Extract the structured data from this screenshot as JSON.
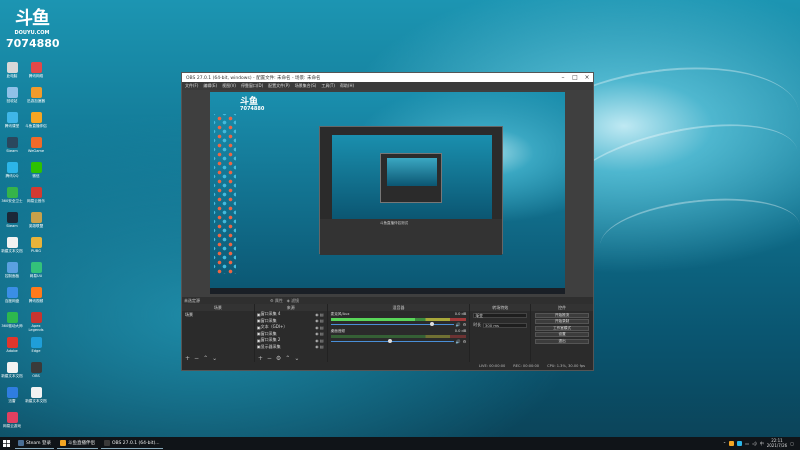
{
  "watermark": {
    "logo": "斗鱼",
    "sub": "DOUYU.COM",
    "room_id": "7074880"
  },
  "desktop_icons": [
    {
      "label": "此电脑",
      "color": "#d8d8d8"
    },
    {
      "label": "腾讯网络",
      "color": "#e34848"
    },
    {
      "label": "回收站",
      "color": "#8fc1e8"
    },
    {
      "label": "迅游加速器",
      "color": "#f29b2b"
    },
    {
      "label": "腾讯课堂",
      "color": "#3fb6e8"
    },
    {
      "label": "斗鱼直播伴侣",
      "color": "#f5a623"
    },
    {
      "label": "Steam",
      "color": "#2a475e"
    },
    {
      "label": "WeGame",
      "color": "#f06a2a"
    },
    {
      "label": "腾讯QQ",
      "color": "#2cb5e8"
    },
    {
      "label": "微信",
      "color": "#2dc100"
    },
    {
      "label": "360安全卫士",
      "color": "#35b34a"
    },
    {
      "label": "网易云音乐",
      "color": "#d33a31"
    },
    {
      "label": "Steam",
      "color": "#1b2838"
    },
    {
      "label": "英雄联盟",
      "color": "#c9a14a"
    },
    {
      "label": "新建文本文档",
      "color": "#f2f2f2"
    },
    {
      "label": "PUBG",
      "color": "#e8b33a"
    },
    {
      "label": "控制面板",
      "color": "#5aa0e0"
    },
    {
      "label": "网易UU",
      "color": "#33c27a"
    },
    {
      "label": "百度网盘",
      "color": "#3a8ee6"
    },
    {
      "label": "腾讯视频",
      "color": "#ff7a1a"
    },
    {
      "label": "360驱动大师",
      "color": "#2db84d"
    },
    {
      "label": "Apex Legends",
      "color": "#c8342f"
    },
    {
      "label": "Adobe",
      "color": "#e0362c"
    },
    {
      "label": "Edge",
      "color": "#1f9ed8"
    },
    {
      "label": "新建文本文档",
      "color": "#f2f2f2"
    },
    {
      "label": "OBS",
      "color": "#3a3a3a"
    },
    {
      "label": "迅雷",
      "color": "#2f7de0"
    },
    {
      "label": "新建文本文档",
      "color": "#f2f2f2"
    },
    {
      "label": "网易云游戏",
      "color": "#e04060"
    }
  ],
  "obs": {
    "title": "OBS 27.0.1 (64-bit, windows) - 配置文件: 未命名 - 场景: 未命名",
    "menu": [
      "文件(F)",
      "编辑(E)",
      "视图(V)",
      "停靠窗口(D)",
      "配置文件(P)",
      "场景集合(S)",
      "工具(T)",
      "帮助(H)"
    ],
    "nested_caption": "斗鱼直播伴侣测试",
    "preview_dock_label": "未选定源",
    "preview_buttons": [
      "属性",
      "滤镜"
    ],
    "docks": {
      "scenes": {
        "title": "场景",
        "items": [
          "场景"
        ]
      },
      "sources": {
        "title": "来源",
        "items": [
          "窗口采集 4",
          "窗口采集",
          "文本（GDI+）",
          "窗口采集",
          "窗口采集 2",
          "显示器采集"
        ]
      },
      "mixer": {
        "title": "混音器",
        "channels": [
          {
            "name": "麦克风/Aux",
            "db": "0.0 dB",
            "level": 62,
            "volume": 82
          },
          {
            "name": "桌面音频",
            "db": "0.0 dB",
            "level": 0,
            "volume": 48
          }
        ],
        "scale": [
          "-60",
          "-55",
          "-50",
          "-45",
          "-40",
          "-35",
          "-30",
          "-25",
          "-20",
          "-15",
          "-10",
          "-5",
          "0"
        ]
      },
      "transitions": {
        "title": "转场特效",
        "type_label": "渐变",
        "duration_label": "时长",
        "duration": "300 ms"
      },
      "controls": {
        "title": "控件",
        "buttons": [
          "开始推流",
          "开始录制",
          "工作室模式",
          "设置",
          "退出"
        ]
      }
    },
    "status": [
      "LIVE: 00:00:00",
      "REC: 00:00:00",
      "CPU: 1.3%, 30.00 fps"
    ]
  },
  "taskbar": {
    "items": [
      {
        "label": "Steam 登录",
        "color": "#4a6e94"
      },
      {
        "label": "斗鱼直播伴侣",
        "color": "#f5a623"
      },
      {
        "label": "OBS 27.0.1 (64-bit)...",
        "color": "#3a3a3a"
      }
    ],
    "clock_time": "22:11",
    "clock_date": "2021/7/26"
  }
}
